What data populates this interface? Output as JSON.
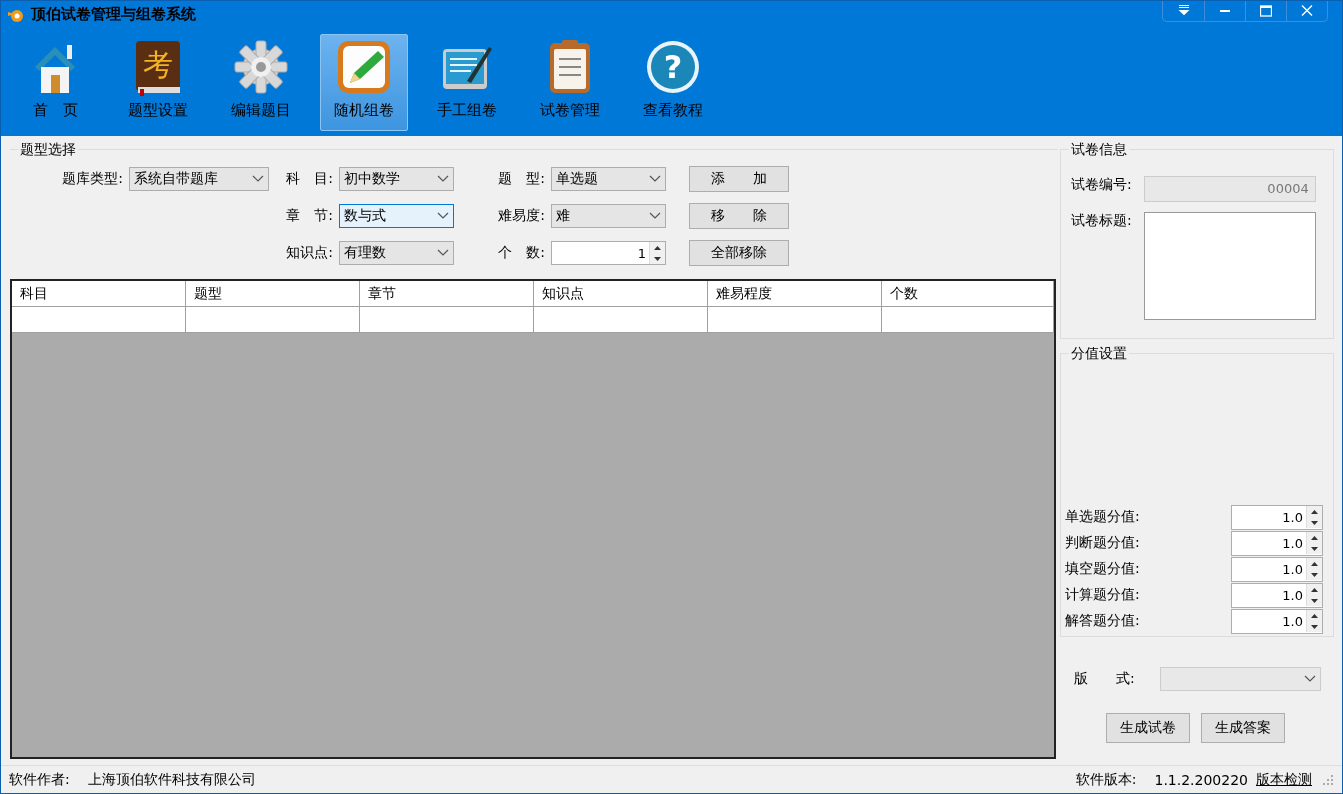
{
  "window": {
    "title": "顶伯试卷管理与组卷系统"
  },
  "toolbar": {
    "items": [
      {
        "label": "首　页",
        "selected": false
      },
      {
        "label": "题型设置",
        "icon_text": "考",
        "selected": false
      },
      {
        "label": "编辑题目",
        "selected": false
      },
      {
        "label": "随机组卷",
        "selected": true
      },
      {
        "label": "手工组卷",
        "selected": false
      },
      {
        "label": "试卷管理",
        "selected": false
      },
      {
        "label": "查看教程",
        "icon_text": "?",
        "selected": false
      }
    ]
  },
  "selection": {
    "title": "题型选择",
    "fields": [
      {
        "kind": "select",
        "label": "题库类型:",
        "value": "系统自带题库",
        "focused": false
      },
      {
        "kind": "select",
        "label": "科　目:",
        "value": "初中数学",
        "focused": false
      },
      {
        "kind": "select",
        "label": "题　型:",
        "value": "单选题",
        "focused": false
      },
      {
        "kind": "blank"
      },
      {
        "kind": "select",
        "label": "章　节:",
        "value": "数与式",
        "focused": true
      },
      {
        "kind": "select",
        "label": "难易度:",
        "value": "难",
        "focused": false
      },
      {
        "kind": "blank"
      },
      {
        "kind": "select",
        "label": "知识点:",
        "value": "有理数",
        "focused": false
      },
      {
        "kind": "spin",
        "label": "个　数:",
        "value": "1"
      }
    ],
    "buttons": [
      "添　　加",
      "移　　除",
      "全部移除"
    ]
  },
  "table": {
    "columns": [
      "科目",
      "题型",
      "章节",
      "知识点",
      "难易程度",
      "个数"
    ]
  },
  "paper_info": {
    "title": "试卷信息",
    "number_label": "试卷编号:",
    "number_value": "00004",
    "title_label": "试卷标题:"
  },
  "score_settings": {
    "title": "分值设置",
    "items": [
      {
        "label": "单选题分值:",
        "value": "1.0"
      },
      {
        "label": "判断题分值:",
        "value": "1.0"
      },
      {
        "label": "填空题分值:",
        "value": "1.0"
      },
      {
        "label": "计算题分值:",
        "value": "1.0"
      },
      {
        "label": "解答题分值:",
        "value": "1.0"
      }
    ]
  },
  "layout_field": {
    "label": "版　　式:",
    "disabled": true
  },
  "actions": [
    "生成试卷",
    "生成答案"
  ],
  "status_bar": {
    "author_label": "软件作者:",
    "author": "上海顶伯软件科技有限公司",
    "version_label": "软件版本:",
    "version": "1.1.2.200220",
    "check_link": "版本检测"
  }
}
